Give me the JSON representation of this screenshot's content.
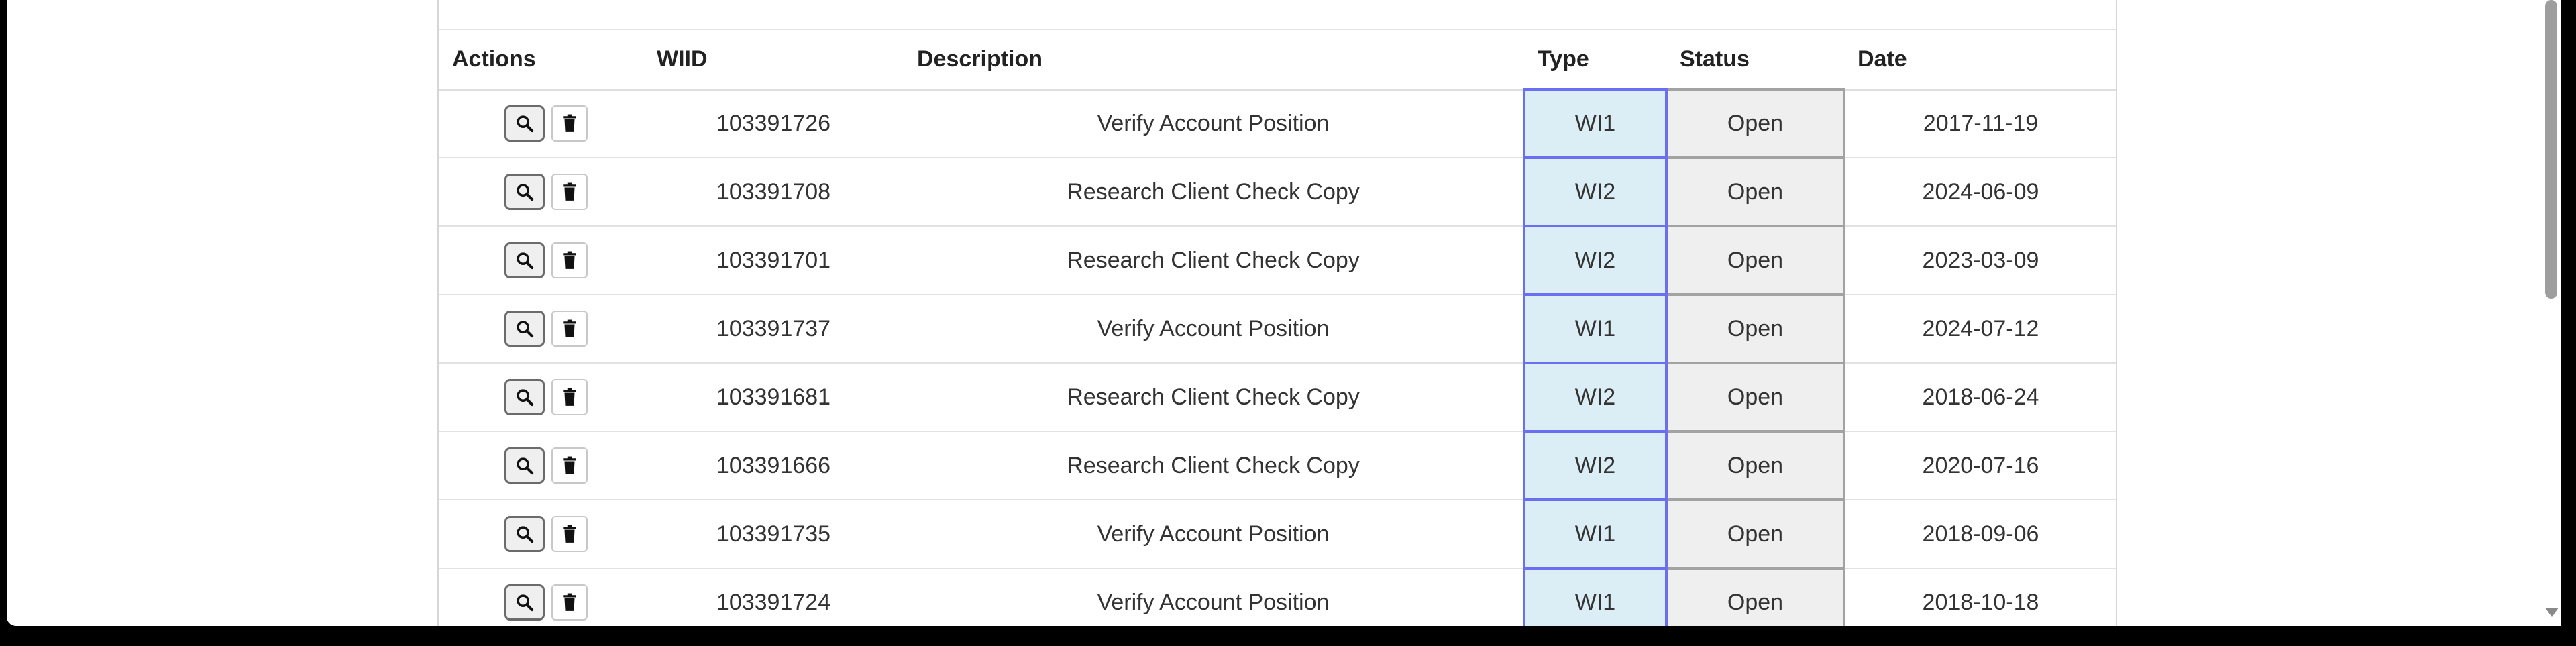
{
  "table": {
    "headers": {
      "actions": "Actions",
      "wiid": "WIID",
      "description": "Description",
      "type": "Type",
      "status": "Status",
      "date": "Date"
    },
    "rows": [
      {
        "wiid": "103391726",
        "description": "Verify Account Position",
        "type": "WI1",
        "status": "Open",
        "date": "2017-11-19"
      },
      {
        "wiid": "103391708",
        "description": "Research Client Check Copy",
        "type": "WI2",
        "status": "Open",
        "date": "2024-06-09"
      },
      {
        "wiid": "103391701",
        "description": "Research Client Check Copy",
        "type": "WI2",
        "status": "Open",
        "date": "2023-03-09"
      },
      {
        "wiid": "103391737",
        "description": "Verify Account Position",
        "type": "WI1",
        "status": "Open",
        "date": "2024-07-12"
      },
      {
        "wiid": "103391681",
        "description": "Research Client Check Copy",
        "type": "WI2",
        "status": "Open",
        "date": "2018-06-24"
      },
      {
        "wiid": "103391666",
        "description": "Research Client Check Copy",
        "type": "WI2",
        "status": "Open",
        "date": "2020-07-16"
      },
      {
        "wiid": "103391735",
        "description": "Verify Account Position",
        "type": "WI1",
        "status": "Open",
        "date": "2018-09-06"
      },
      {
        "wiid": "103391724",
        "description": "Verify Account Position",
        "type": "WI1",
        "status": "Open",
        "date": "2018-10-18"
      }
    ]
  },
  "icons": {
    "view": "search-icon",
    "delete": "trash-icon"
  },
  "colors": {
    "type_cell_bg": "#dceef5",
    "type_cell_border": "#6a6ef0",
    "status_cell_bg": "#efefef",
    "status_cell_border": "#a2a2a2"
  }
}
